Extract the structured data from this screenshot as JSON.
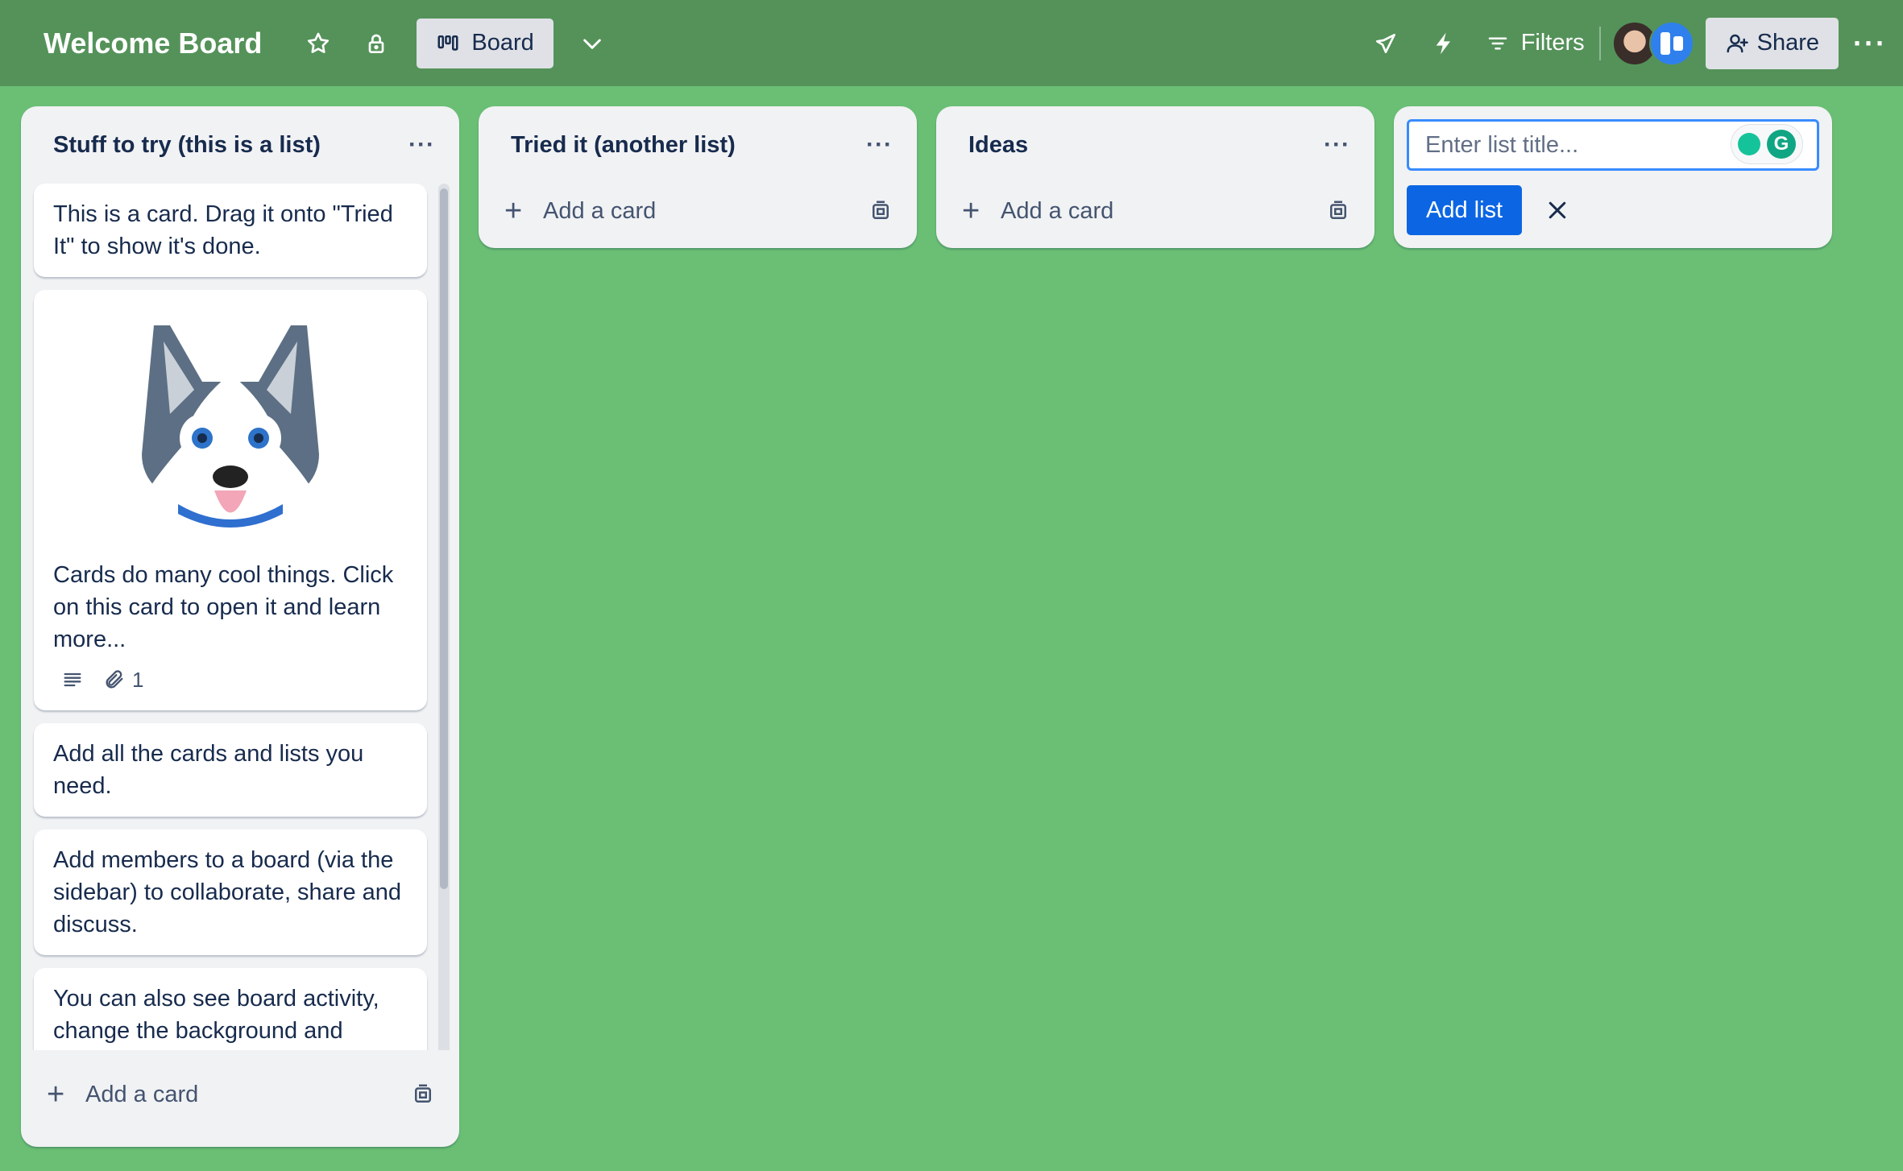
{
  "board": {
    "title": "Welcome Board",
    "view_label": "Board",
    "filters_label": "Filters",
    "share_label": "Share"
  },
  "lists": [
    {
      "title": "Stuff to try (this is a list)",
      "add_card_label": "Add a card",
      "cards": [
        {
          "text": "This is a card. Drag it onto \"Tried It\" to show it's done."
        },
        {
          "text": "Cards do many cool things. Click on this card to open it and learn more...",
          "cover": "husky-image",
          "attachments": "1"
        },
        {
          "text": "Add all the cards and lists you need."
        },
        {
          "text": "Add members to a board (via the sidebar) to collaborate, share and discuss."
        },
        {
          "text": "You can also see board activity, change the background and more."
        }
      ]
    },
    {
      "title": "Tried it (another list)",
      "add_card_label": "Add a card"
    },
    {
      "title": "Ideas",
      "add_card_label": "Add a card"
    }
  ],
  "new_list": {
    "placeholder": "Enter list title...",
    "add_button": "Add list"
  },
  "colors": {
    "background": "#6abf74",
    "header": "#549259",
    "primary_button": "#0c66e4"
  }
}
